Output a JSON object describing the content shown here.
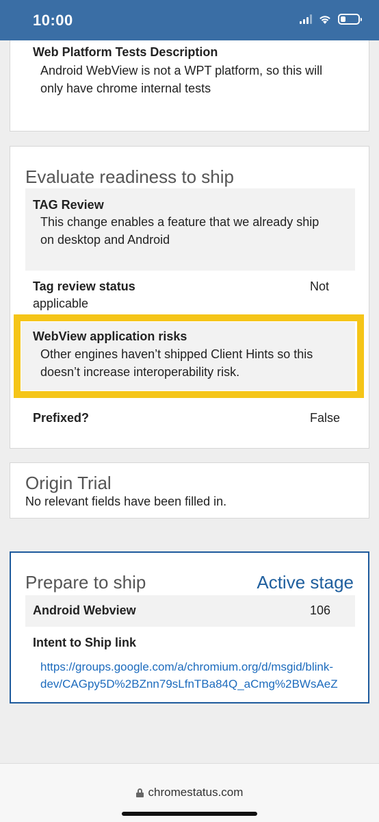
{
  "status_bar": {
    "time": "10:00"
  },
  "wpt_card": {
    "label": "Web Platform Tests Description",
    "text_line1": "Android WebView is not a WPT platform, so this will",
    "text_line2": "only have chrome internal tests"
  },
  "ship_card": {
    "title": "Evaluate readiness to ship",
    "tag_review_label": "TAG Review",
    "tag_review_line1": "This change enables a feature that we already ship",
    "tag_review_line2": "on desktop and Android",
    "tag_status_label": "Tag review status",
    "tag_status_value_1": "Not",
    "tag_status_value_2": "applicable",
    "risks_label": "WebView application risks",
    "risks_line1": "Other engines haven’t shipped Client Hints so this",
    "risks_line2": "doesn’t increase interoperability risk.",
    "prefixed_label": "Prefixed?",
    "prefixed_value": "False"
  },
  "origin_card": {
    "title": "Origin Trial",
    "text": "No relevant fields have been filled in."
  },
  "prepare_card": {
    "title": "Prepare to ship",
    "active_stage": "Active stage",
    "webview_label": "Android Webview",
    "webview_value": "106",
    "intent_label": "Intent to Ship link",
    "link_line1": "https://groups.google.com/a/chromium.org/d/msgid/blink-",
    "link_line2": "dev/CAGpy5D%2BZnn79sLfnTBa84Q_aCmg%2BWsAeZ"
  },
  "browser": {
    "url": "chromestatus.com"
  },
  "colors": {
    "header": "#3a6ea5",
    "highlight": "#f5c518",
    "link": "#1c6bbd",
    "active_border": "#1d5a9c"
  },
  "icons": [
    "signal-icon",
    "wifi-icon",
    "battery-icon",
    "lock-icon"
  ]
}
